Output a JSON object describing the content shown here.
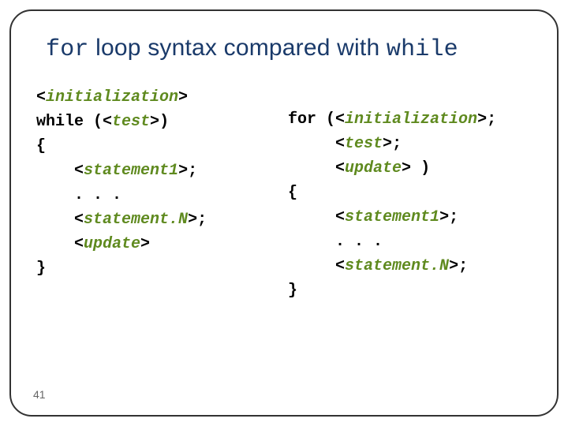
{
  "title": {
    "pre": "for",
    "mid": " loop syntax compared with ",
    "post": "while"
  },
  "left": {
    "l1": "initialization",
    "l2a": "while (",
    "l2b": "test",
    "l2c": ")",
    "l3": "{",
    "l4": "statement1",
    "l5": "    . . .",
    "l6": "statement.N",
    "l7": "update",
    "l8": "}"
  },
  "right": {
    "r1a": "for (",
    "r1b": "initialization",
    "r1c": ";",
    "r2": "test",
    "r2b": ";",
    "r3": "update",
    "r3b": " )",
    "r4": "{",
    "r5": "statement1",
    "r6": "     . . .",
    "r7": "statement.N",
    "r8": "}"
  },
  "page": "41"
}
